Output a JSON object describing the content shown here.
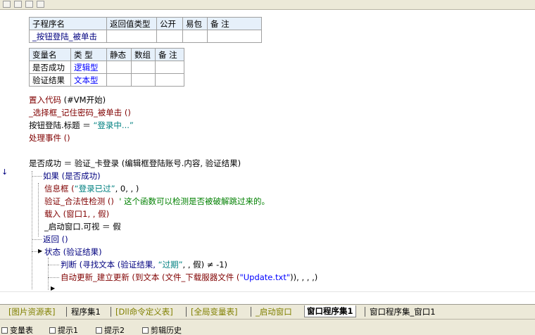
{
  "sub_table": {
    "headers": [
      "子程序名",
      "返回值类型",
      "公开",
      "易包",
      "备 注"
    ],
    "row": [
      "_按钮登陆_被单击",
      "",
      "",
      "",
      ""
    ]
  },
  "var_table": {
    "headers": [
      "变量名",
      "类 型",
      "静态",
      "数组",
      "备 注"
    ],
    "rows": [
      [
        "是否成功",
        "逻辑型",
        "",
        "",
        ""
      ],
      [
        "验证结果",
        "文本型",
        "",
        "",
        ""
      ]
    ]
  },
  "code": {
    "l1a": "置入代码",
    "l1b": " (#VM开始)",
    "l2": "_选择框_记住密码_被单击 ()",
    "l3a": "按钮登陆.标题 ＝ ",
    "l3b": "“登录中...”",
    "l4": "处理事件 ()",
    "l5": "是否成功 ＝ 验证_卡登录 (编辑框登陆账号.内容, 验证结果)",
    "l6": "如果 (是否成功)",
    "l7a": "信息框 (",
    "l7b": "“登录已过”",
    "l7c": ", 0, , )",
    "l8a": "验证_合法性检测 ()  ",
    "l8b": "' 这个函数可以检测是否被破解跳过来的。",
    "l9": "载入 (窗口1, , 假)",
    "l10": "_启动窗口.可视 ＝ 假",
    "l11": "返回 ()",
    "l12": "状态 (验证结果)",
    "l13a": "判断 (寻找文本 (验证结果, ",
    "l13b": "“过期”",
    "l13c": ", , 假) ≠ -1)",
    "l14a": "自动更新_建立更新 (到文本 (文件_下载服器文件 (",
    "l14b": "\"Update.txt\"",
    "l14c": ")), , , ,)"
  },
  "tabs": [
    "[图片资源表]",
    "程序集1",
    "[Dll命令定义表]",
    "[全局变量表]",
    "_启动窗口",
    "窗口程序集1",
    "窗口程序集_窗口1"
  ],
  "bottom_tabs": [
    "变量表",
    "提示1",
    "提示2",
    "剪辑历史"
  ]
}
